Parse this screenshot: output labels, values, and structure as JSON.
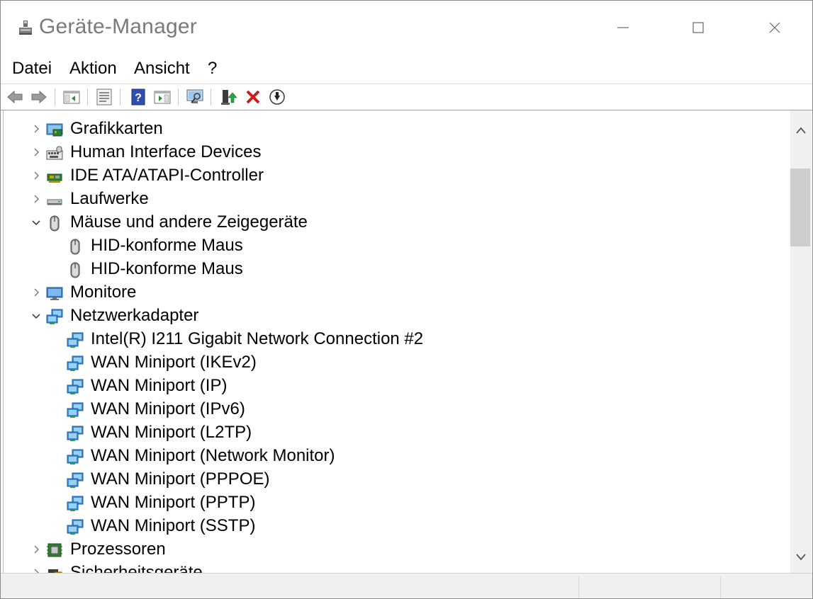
{
  "window": {
    "title": "Geräte-Manager",
    "icon": "device-manager-icon"
  },
  "menubar": {
    "items": [
      {
        "label": "Datei"
      },
      {
        "label": "Aktion"
      },
      {
        "label": "Ansicht"
      },
      {
        "label": "?"
      }
    ]
  },
  "toolbar": {
    "buttons": [
      {
        "icon": "back-arrow-icon"
      },
      {
        "icon": "forward-arrow-icon"
      },
      {
        "icon": "show-hide-console-tree-icon"
      },
      {
        "icon": "properties-icon"
      },
      {
        "icon": "help-icon"
      },
      {
        "icon": "show-action-pane-icon"
      },
      {
        "icon": "scan-hardware-icon"
      },
      {
        "icon": "update-driver-icon"
      },
      {
        "icon": "uninstall-device-icon"
      },
      {
        "icon": "disable-device-icon"
      }
    ]
  },
  "tree": {
    "items": [
      {
        "label": "Grafikkarten",
        "level": 0,
        "state": "collapsed",
        "icon": "display-adapter-icon"
      },
      {
        "label": "Human Interface Devices",
        "level": 0,
        "state": "collapsed",
        "icon": "hid-icon"
      },
      {
        "label": "IDE ATA/ATAPI-Controller",
        "level": 0,
        "state": "collapsed",
        "icon": "ide-controller-icon"
      },
      {
        "label": "Laufwerke",
        "level": 0,
        "state": "collapsed",
        "icon": "drive-icon"
      },
      {
        "label": "Mäuse und andere Zeigegeräte",
        "level": 0,
        "state": "expanded",
        "icon": "mouse-icon"
      },
      {
        "label": "HID-konforme Maus",
        "level": 1,
        "icon": "mouse-icon"
      },
      {
        "label": "HID-konforme Maus",
        "level": 1,
        "icon": "mouse-icon"
      },
      {
        "label": "Monitore",
        "level": 0,
        "state": "collapsed",
        "icon": "monitor-icon"
      },
      {
        "label": "Netzwerkadapter",
        "level": 0,
        "state": "expanded",
        "icon": "network-adapter-icon"
      },
      {
        "label": "Intel(R) I211 Gigabit Network Connection #2",
        "level": 1,
        "icon": "network-adapter-icon"
      },
      {
        "label": "WAN Miniport (IKEv2)",
        "level": 1,
        "icon": "network-adapter-icon"
      },
      {
        "label": "WAN Miniport (IP)",
        "level": 1,
        "icon": "network-adapter-icon"
      },
      {
        "label": "WAN Miniport (IPv6)",
        "level": 1,
        "icon": "network-adapter-icon"
      },
      {
        "label": "WAN Miniport (L2TP)",
        "level": 1,
        "icon": "network-adapter-icon"
      },
      {
        "label": "WAN Miniport (Network Monitor)",
        "level": 1,
        "icon": "network-adapter-icon"
      },
      {
        "label": "WAN Miniport (PPPOE)",
        "level": 1,
        "icon": "network-adapter-icon"
      },
      {
        "label": "WAN Miniport (PPTP)",
        "level": 1,
        "icon": "network-adapter-icon"
      },
      {
        "label": "WAN Miniport (SSTP)",
        "level": 1,
        "icon": "network-adapter-icon"
      },
      {
        "label": "Prozessoren",
        "level": 0,
        "state": "collapsed",
        "icon": "processor-icon"
      },
      {
        "label": "Sicherheitsgeräte",
        "level": 0,
        "state": "collapsed",
        "icon": "security-device-icon"
      }
    ]
  }
}
